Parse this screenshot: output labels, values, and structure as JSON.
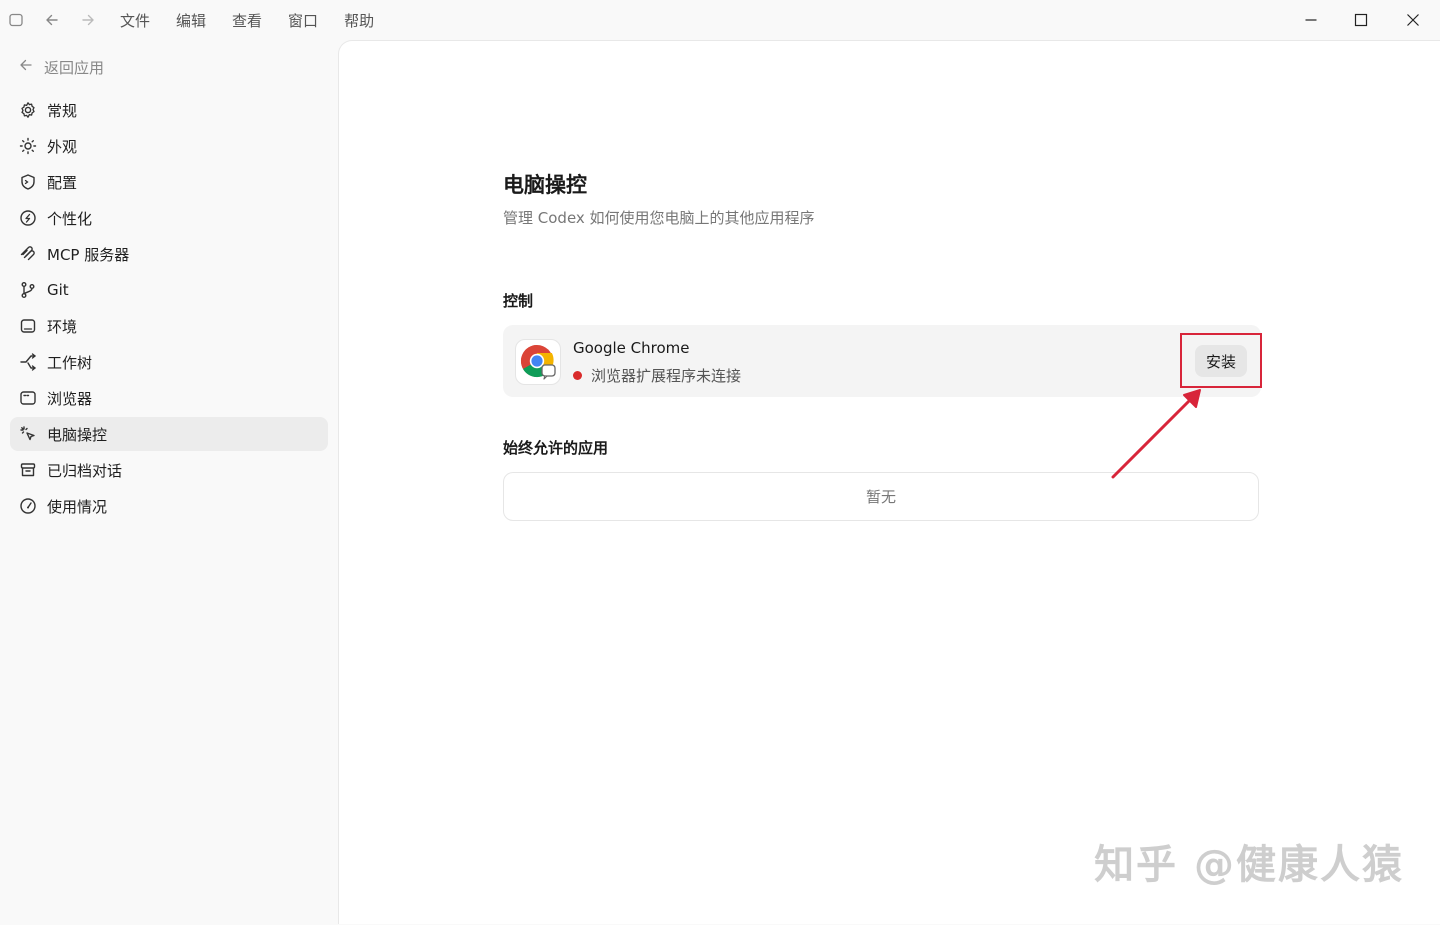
{
  "titlebar": {
    "menu": [
      "文件",
      "编辑",
      "查看",
      "窗口",
      "帮助"
    ]
  },
  "sidebar": {
    "back_label": "返回应用",
    "items": [
      {
        "label": "常规",
        "icon": "gear-icon"
      },
      {
        "label": "外观",
        "icon": "sun-icon"
      },
      {
        "label": "配置",
        "icon": "config-shield-icon"
      },
      {
        "label": "个性化",
        "icon": "personalize-icon"
      },
      {
        "label": "MCP 服务器",
        "icon": "mcp-icon"
      },
      {
        "label": "Git",
        "icon": "git-branch-icon"
      },
      {
        "label": "环境",
        "icon": "environment-icon"
      },
      {
        "label": "工作树",
        "icon": "worktree-icon"
      },
      {
        "label": "浏览器",
        "icon": "browser-icon"
      },
      {
        "label": "电脑操控",
        "icon": "cursor-click-icon",
        "active": true
      },
      {
        "label": "已归档对话",
        "icon": "archive-icon"
      },
      {
        "label": "使用情况",
        "icon": "gauge-icon"
      }
    ]
  },
  "main": {
    "title": "电脑操控",
    "subtitle": "管理 Codex 如何使用您电脑上的其他应用程序",
    "control_section": {
      "label": "控制",
      "app": {
        "name": "Google Chrome",
        "status": "浏览器扩展程序未连接",
        "status_color": "#d92b2b",
        "action_label": "安装"
      }
    },
    "allowed_section": {
      "label": "始终允许的应用",
      "empty_text": "暂无"
    }
  },
  "annotation": {
    "highlight_color": "#d8253a"
  },
  "watermark": "知乎 @健康人猿"
}
